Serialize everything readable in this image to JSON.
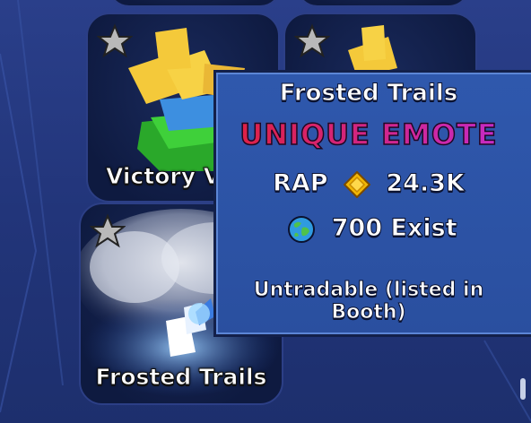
{
  "grid": {
    "items": [
      {
        "label": "Victory V",
        "icon": "star-icon"
      },
      {
        "label": "",
        "icon": "star-icon"
      },
      {
        "label": "Frosted Trails",
        "icon": "star-icon"
      }
    ]
  },
  "tooltip": {
    "title": "Frosted Trails",
    "rarity": "UNIQUE EMOTE",
    "rap_label": "RAP",
    "rap_value": "24.3K",
    "exist_text": "700 Exist",
    "tradable_text": "Untradable (listed in Booth)"
  },
  "colors": {
    "background": "#22357a",
    "tooltip_bg": "#2f58ad",
    "rarity_start": "#e0203a",
    "rarity_end": "#c42bd0"
  }
}
